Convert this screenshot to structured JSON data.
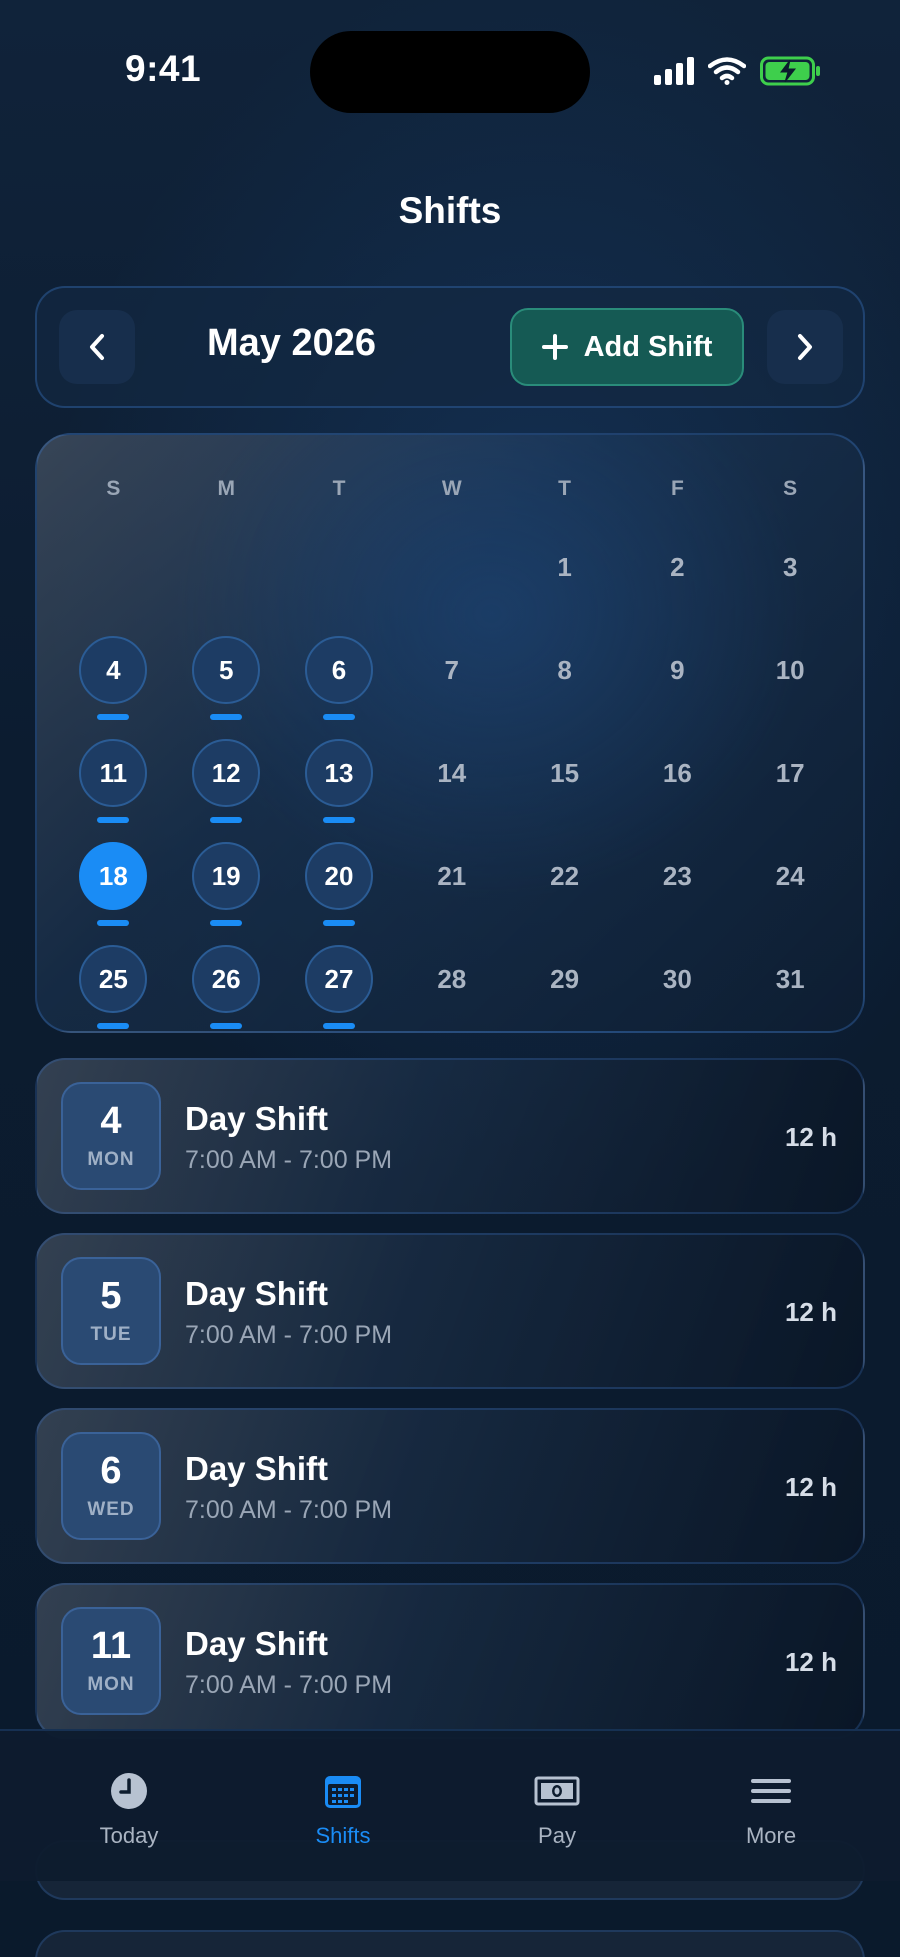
{
  "status_bar": {
    "time": "9:41"
  },
  "header": {
    "title": "Shifts"
  },
  "month_bar": {
    "month_label": "May 2026",
    "add_shift_label": "Add Shift"
  },
  "calendar": {
    "weekdays": [
      "S",
      "M",
      "T",
      "W",
      "T",
      "F",
      "S"
    ],
    "weeks": [
      [
        {
          "day": "",
          "shift": false,
          "today": false
        },
        {
          "day": "",
          "shift": false,
          "today": false
        },
        {
          "day": "",
          "shift": false,
          "today": false
        },
        {
          "day": "",
          "shift": false,
          "today": false
        },
        {
          "day": "1",
          "shift": false,
          "today": false
        },
        {
          "day": "2",
          "shift": false,
          "today": false
        },
        {
          "day": "3",
          "shift": false,
          "today": false
        }
      ],
      [
        {
          "day": "4",
          "shift": true,
          "today": false
        },
        {
          "day": "5",
          "shift": true,
          "today": false
        },
        {
          "day": "6",
          "shift": true,
          "today": false
        },
        {
          "day": "7",
          "shift": false,
          "today": false
        },
        {
          "day": "8",
          "shift": false,
          "today": false
        },
        {
          "day": "9",
          "shift": false,
          "today": false
        },
        {
          "day": "10",
          "shift": false,
          "today": false
        }
      ],
      [
        {
          "day": "11",
          "shift": true,
          "today": false
        },
        {
          "day": "12",
          "shift": true,
          "today": false
        },
        {
          "day": "13",
          "shift": true,
          "today": false
        },
        {
          "day": "14",
          "shift": false,
          "today": false
        },
        {
          "day": "15",
          "shift": false,
          "today": false
        },
        {
          "day": "16",
          "shift": false,
          "today": false
        },
        {
          "day": "17",
          "shift": false,
          "today": false
        }
      ],
      [
        {
          "day": "18",
          "shift": true,
          "today": true
        },
        {
          "day": "19",
          "shift": true,
          "today": false
        },
        {
          "day": "20",
          "shift": true,
          "today": false
        },
        {
          "day": "21",
          "shift": false,
          "today": false
        },
        {
          "day": "22",
          "shift": false,
          "today": false
        },
        {
          "day": "23",
          "shift": false,
          "today": false
        },
        {
          "day": "24",
          "shift": false,
          "today": false
        }
      ],
      [
        {
          "day": "25",
          "shift": true,
          "today": false
        },
        {
          "day": "26",
          "shift": true,
          "today": false
        },
        {
          "day": "27",
          "shift": true,
          "today": false
        },
        {
          "day": "28",
          "shift": false,
          "today": false
        },
        {
          "day": "29",
          "shift": false,
          "today": false
        },
        {
          "day": "30",
          "shift": false,
          "today": false
        },
        {
          "day": "31",
          "shift": false,
          "today": false
        }
      ]
    ]
  },
  "shifts": [
    {
      "day": "4",
      "weekday": "MON",
      "title": "Day Shift",
      "time": "7:00 AM - 7:00 PM",
      "hours": "12 h"
    },
    {
      "day": "5",
      "weekday": "TUE",
      "title": "Day Shift",
      "time": "7:00 AM - 7:00 PM",
      "hours": "12 h"
    },
    {
      "day": "6",
      "weekday": "WED",
      "title": "Day Shift",
      "time": "7:00 AM - 7:00 PM",
      "hours": "12 h"
    },
    {
      "day": "11",
      "weekday": "MON",
      "title": "Day Shift",
      "time": "7:00 AM - 7:00 PM",
      "hours": "12 h"
    }
  ],
  "tab_bar": {
    "items": [
      {
        "label": "Today",
        "icon": "clock-icon",
        "active": false
      },
      {
        "label": "Shifts",
        "icon": "calendar-icon",
        "active": true
      },
      {
        "label": "Pay",
        "icon": "cash-icon",
        "active": false
      },
      {
        "label": "More",
        "icon": "menu-icon",
        "active": false
      }
    ]
  },
  "colors": {
    "accent": "#1a8cf5",
    "add_shift_bg": "#155a54",
    "background": "#0b1b2d"
  }
}
